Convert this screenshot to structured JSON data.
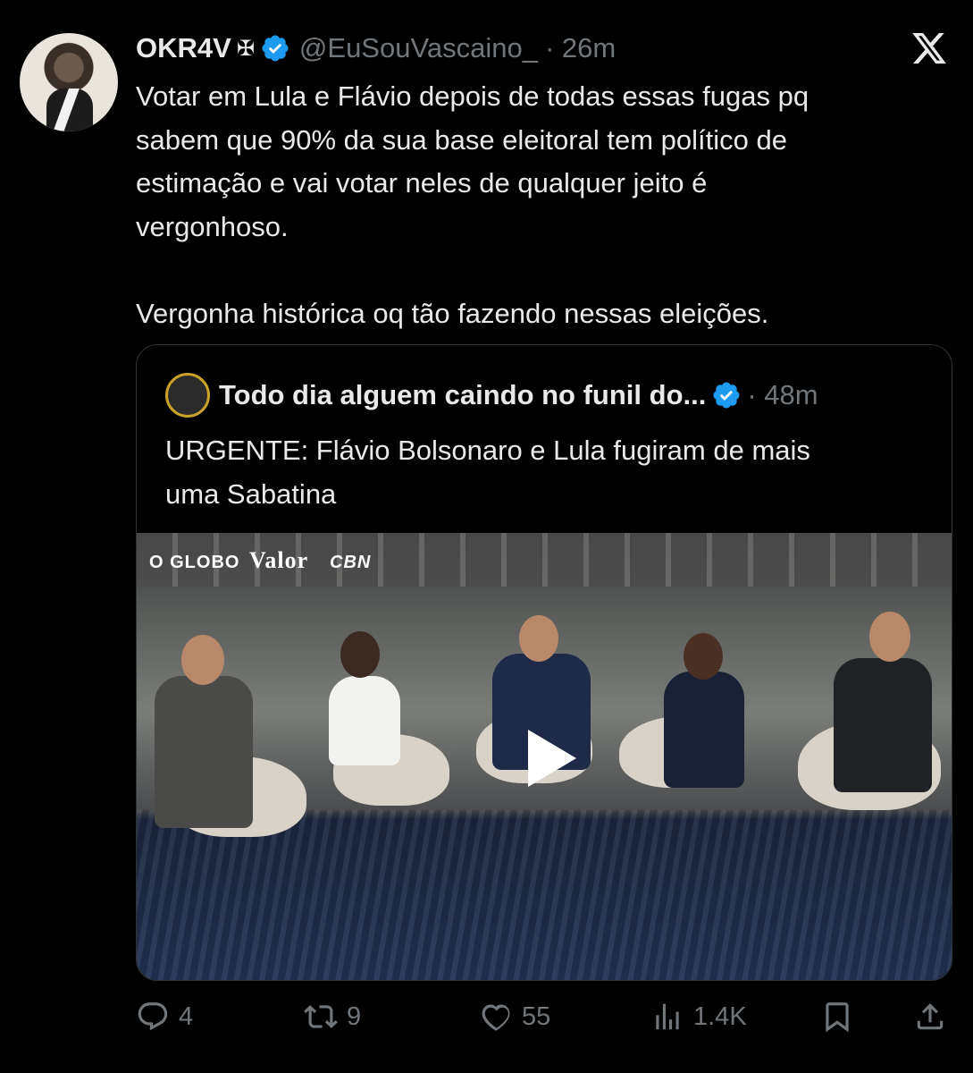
{
  "tweet": {
    "author_name": "OKR4V",
    "author_emblem": "✠",
    "handle": "@EuSouVascaino_",
    "time": "· 26m",
    "text_line1": "Votar em Lula e Flávio depois de todas essas fugas pq",
    "text_line2": "sabem que 90% da sua base eleitoral tem político de",
    "text_line3": "estimação e vai votar neles de qualquer jeito é",
    "text_line4": "vergonhoso.",
    "text_line5": "Vergonha histórica oq tão fazendo nessas eleições."
  },
  "quote": {
    "author_name": "Todo dia alguem caindo no funil do...",
    "time": "· 48m",
    "text_line1": "URGENTE: Flávio Bolsonaro e Lula fugiram de mais",
    "text_line2": "uma Sabatina",
    "media_brands": [
      "O GLOBO",
      "Valor",
      "CBN"
    ]
  },
  "actions": {
    "replies": "4",
    "reposts": "9",
    "likes": "55",
    "views": "1.4K"
  },
  "colors": {
    "background": "#000000",
    "text": "#e7e9ea",
    "muted": "#71767b",
    "verified": "#1d9bf0"
  },
  "icons": [
    "verified-icon",
    "x-logo-icon",
    "reply-icon",
    "repost-icon",
    "like-icon",
    "views-icon",
    "bookmark-icon",
    "share-icon",
    "play-icon"
  ]
}
